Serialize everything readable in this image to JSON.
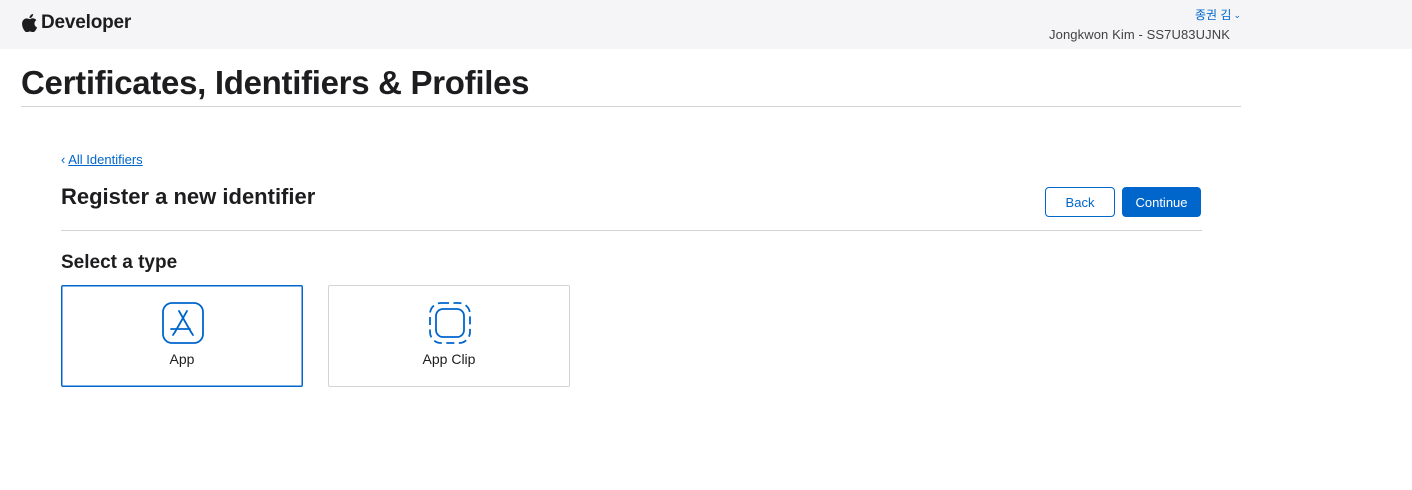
{
  "header": {
    "brand_name": "Developer",
    "user_name": "종권 김",
    "team_info": "Jongkwon Kim - SS7U83UJNK"
  },
  "page": {
    "title": "Certificates, Identifiers & Profiles"
  },
  "form": {
    "back_link": "All Identifiers",
    "heading": "Register a new identifier",
    "back_button": "Back",
    "continue_button": "Continue",
    "select_label": "Select a type",
    "types": [
      {
        "label": "App",
        "icon": "app-store-icon",
        "selected": true
      },
      {
        "label": "App Clip",
        "icon": "app-clip-icon",
        "selected": false
      }
    ]
  },
  "colors": {
    "accent": "#0066cc",
    "header_bg": "#f5f5f7",
    "divider": "#d2d2d7"
  }
}
